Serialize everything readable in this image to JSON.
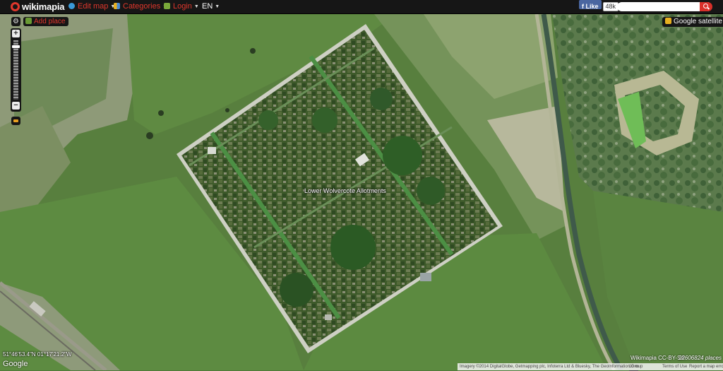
{
  "header": {
    "logo": "wikimapia",
    "menu": [
      {
        "label": "Edit map",
        "icon": "globe-icon",
        "color": "#e0372c"
      },
      {
        "label": "Categories",
        "icon": "categories-icon",
        "color": "#e0372c"
      },
      {
        "label": "Login",
        "icon": "login-icon",
        "color": "#e0372c"
      },
      {
        "label": "EN",
        "icon": "",
        "color": "#ffffff"
      }
    ],
    "facebook": {
      "like_label": "Like",
      "count": "48k"
    },
    "search": {
      "placeholder": "",
      "value": ""
    }
  },
  "map": {
    "add_place_label": "Add place",
    "layer_button_label": "Google satellite",
    "place_label": "Lower Wolvercote Allotments",
    "coordinates": "51°46'53.4\"N 01°17'21.2\"W",
    "provider_logo": "Google",
    "license": "Wikimapia CC-BY-SA",
    "place_count": "22606824 places",
    "attribution": {
      "imagery": "Imagery ©2014 DigitalGlobe, Getmapping plc, Infoterra Ltd & Bluesky, The GeoInformation Group",
      "scale": "10 m",
      "terms": "Terms of Use",
      "report": "Report a map error"
    }
  },
  "colors": {
    "accent": "#e0372c",
    "bar": "#161616"
  }
}
